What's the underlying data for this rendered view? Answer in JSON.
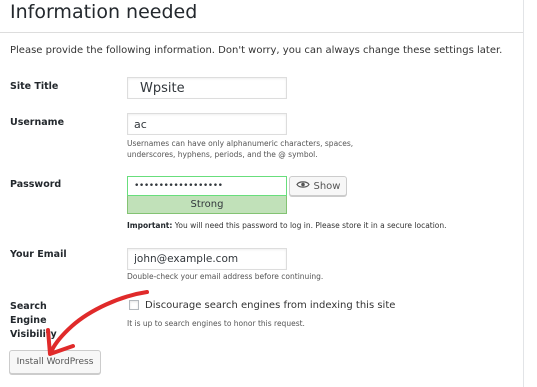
{
  "page": {
    "title": "Information needed",
    "intro": "Please provide the following information. Don't worry, you can always change these settings later."
  },
  "site_title": {
    "label": "Site Title",
    "value": "Wpsite"
  },
  "username": {
    "label": "Username",
    "value": "ac",
    "description": "Usernames can have only alphanumeric characters, spaces, underscores, hyphens, periods, and the @ symbol."
  },
  "password": {
    "label": "Password",
    "value": "••••••••••••••••••",
    "strength": "Strong",
    "show_label": "Show",
    "show_icon": "eye-icon",
    "important_prefix": "Important:",
    "important_text": " You will need this password to log in. Please store it in a secure location."
  },
  "email": {
    "label": "Your Email",
    "value": "john@example.com",
    "description": "Double-check your email address before continuing."
  },
  "visibility": {
    "label": "Search Engine Visibility",
    "checkbox_label": "Discourage search engines from indexing this site",
    "checked": false,
    "description": "It is up to search engines to honor this request."
  },
  "install_button": {
    "label": "Install WordPress"
  },
  "annotation": {
    "arrow_color": "#e02a2a"
  },
  "colors": {
    "strength_bg": "#c1e1b9",
    "strength_border": "#83c373",
    "password_border": "#68de7c"
  }
}
